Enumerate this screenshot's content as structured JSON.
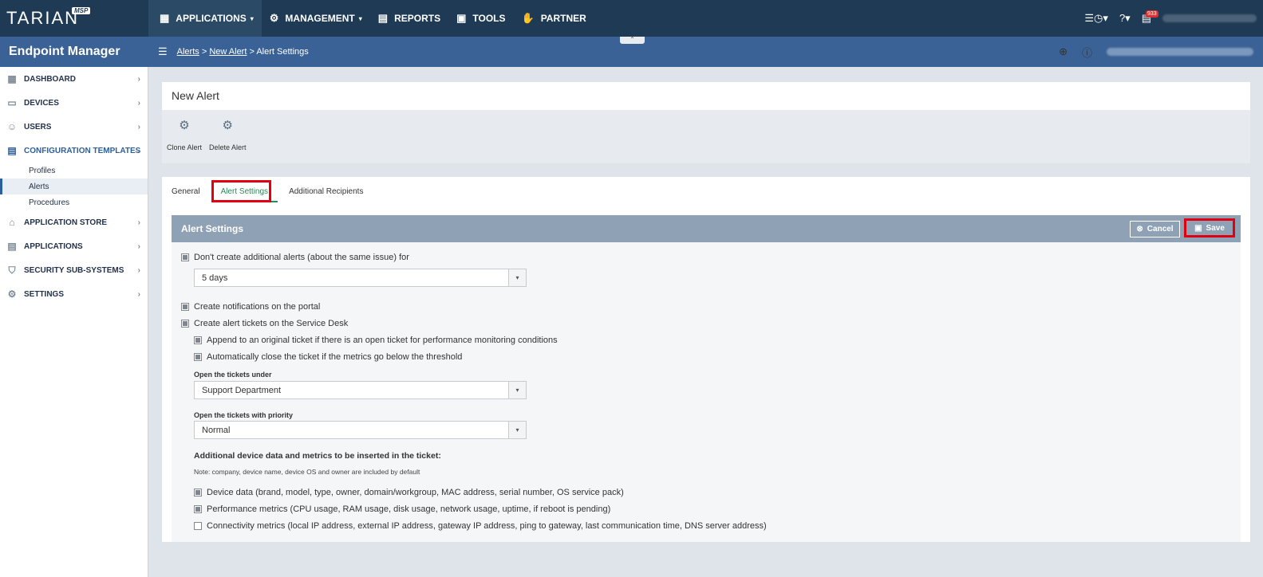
{
  "app": {
    "logo_text": "TARIAN",
    "logo_badge": "MSP",
    "product": "Endpoint Manager"
  },
  "topnav": {
    "applications": "APPLICATIONS",
    "management": "MANAGEMENT",
    "reports": "REPORTS",
    "tools": "TOOLS",
    "partner": "PARTNER",
    "notification_count": "933"
  },
  "breadcrumb": {
    "alerts": "Alerts",
    "sep1": " > ",
    "new_alert": "New Alert",
    "sep2": " > ",
    "current": "Alert Settings"
  },
  "sidebar": {
    "items": [
      {
        "label": "DASHBOARD"
      },
      {
        "label": "DEVICES"
      },
      {
        "label": "USERS"
      },
      {
        "label": "CONFIGURATION TEMPLATES"
      },
      {
        "label": "APPLICATION STORE"
      },
      {
        "label": "APPLICATIONS"
      },
      {
        "label": "SECURITY SUB-SYSTEMS"
      },
      {
        "label": "SETTINGS"
      }
    ],
    "subitems": [
      {
        "label": "Profiles"
      },
      {
        "label": "Alerts"
      },
      {
        "label": "Procedures"
      }
    ]
  },
  "page": {
    "title": "New Alert",
    "toolbar": {
      "clone": "Clone Alert",
      "delete": "Delete Alert"
    },
    "tabs": [
      {
        "label": "General"
      },
      {
        "label": "Alert Settings"
      },
      {
        "label": "Additional Recipients"
      }
    ]
  },
  "settings": {
    "header": "Alert Settings",
    "cancel": "Cancel",
    "save": "Save",
    "dont_create": "Don't create additional alerts (about the same issue) for",
    "duration_value": "5 days",
    "create_notifications": "Create notifications on the portal",
    "create_tickets": "Create alert tickets on the Service Desk",
    "append_ticket": "Append to an original ticket if there is an open ticket for performance monitoring conditions",
    "auto_close": "Automatically close the ticket if the metrics go below the threshold",
    "open_under_label": "Open the tickets under",
    "open_under_value": "Support Department",
    "priority_label": "Open the tickets with priority",
    "priority_value": "Normal",
    "additional_heading": "Additional device data and metrics to be inserted in the ticket:",
    "note": "Note: company, device name, device OS and owner are included by default",
    "device_data": "Device data (brand, model, type, owner, domain/workgroup, MAC address, serial number, OS service pack)",
    "performance_metrics": "Performance metrics (CPU usage, RAM usage, disk usage, network usage, uptime, if reboot is pending)",
    "connectivity_metrics": "Connectivity metrics (local IP address, external IP address, gateway IP address, ping to gateway, last communication time, DNS server address)"
  }
}
